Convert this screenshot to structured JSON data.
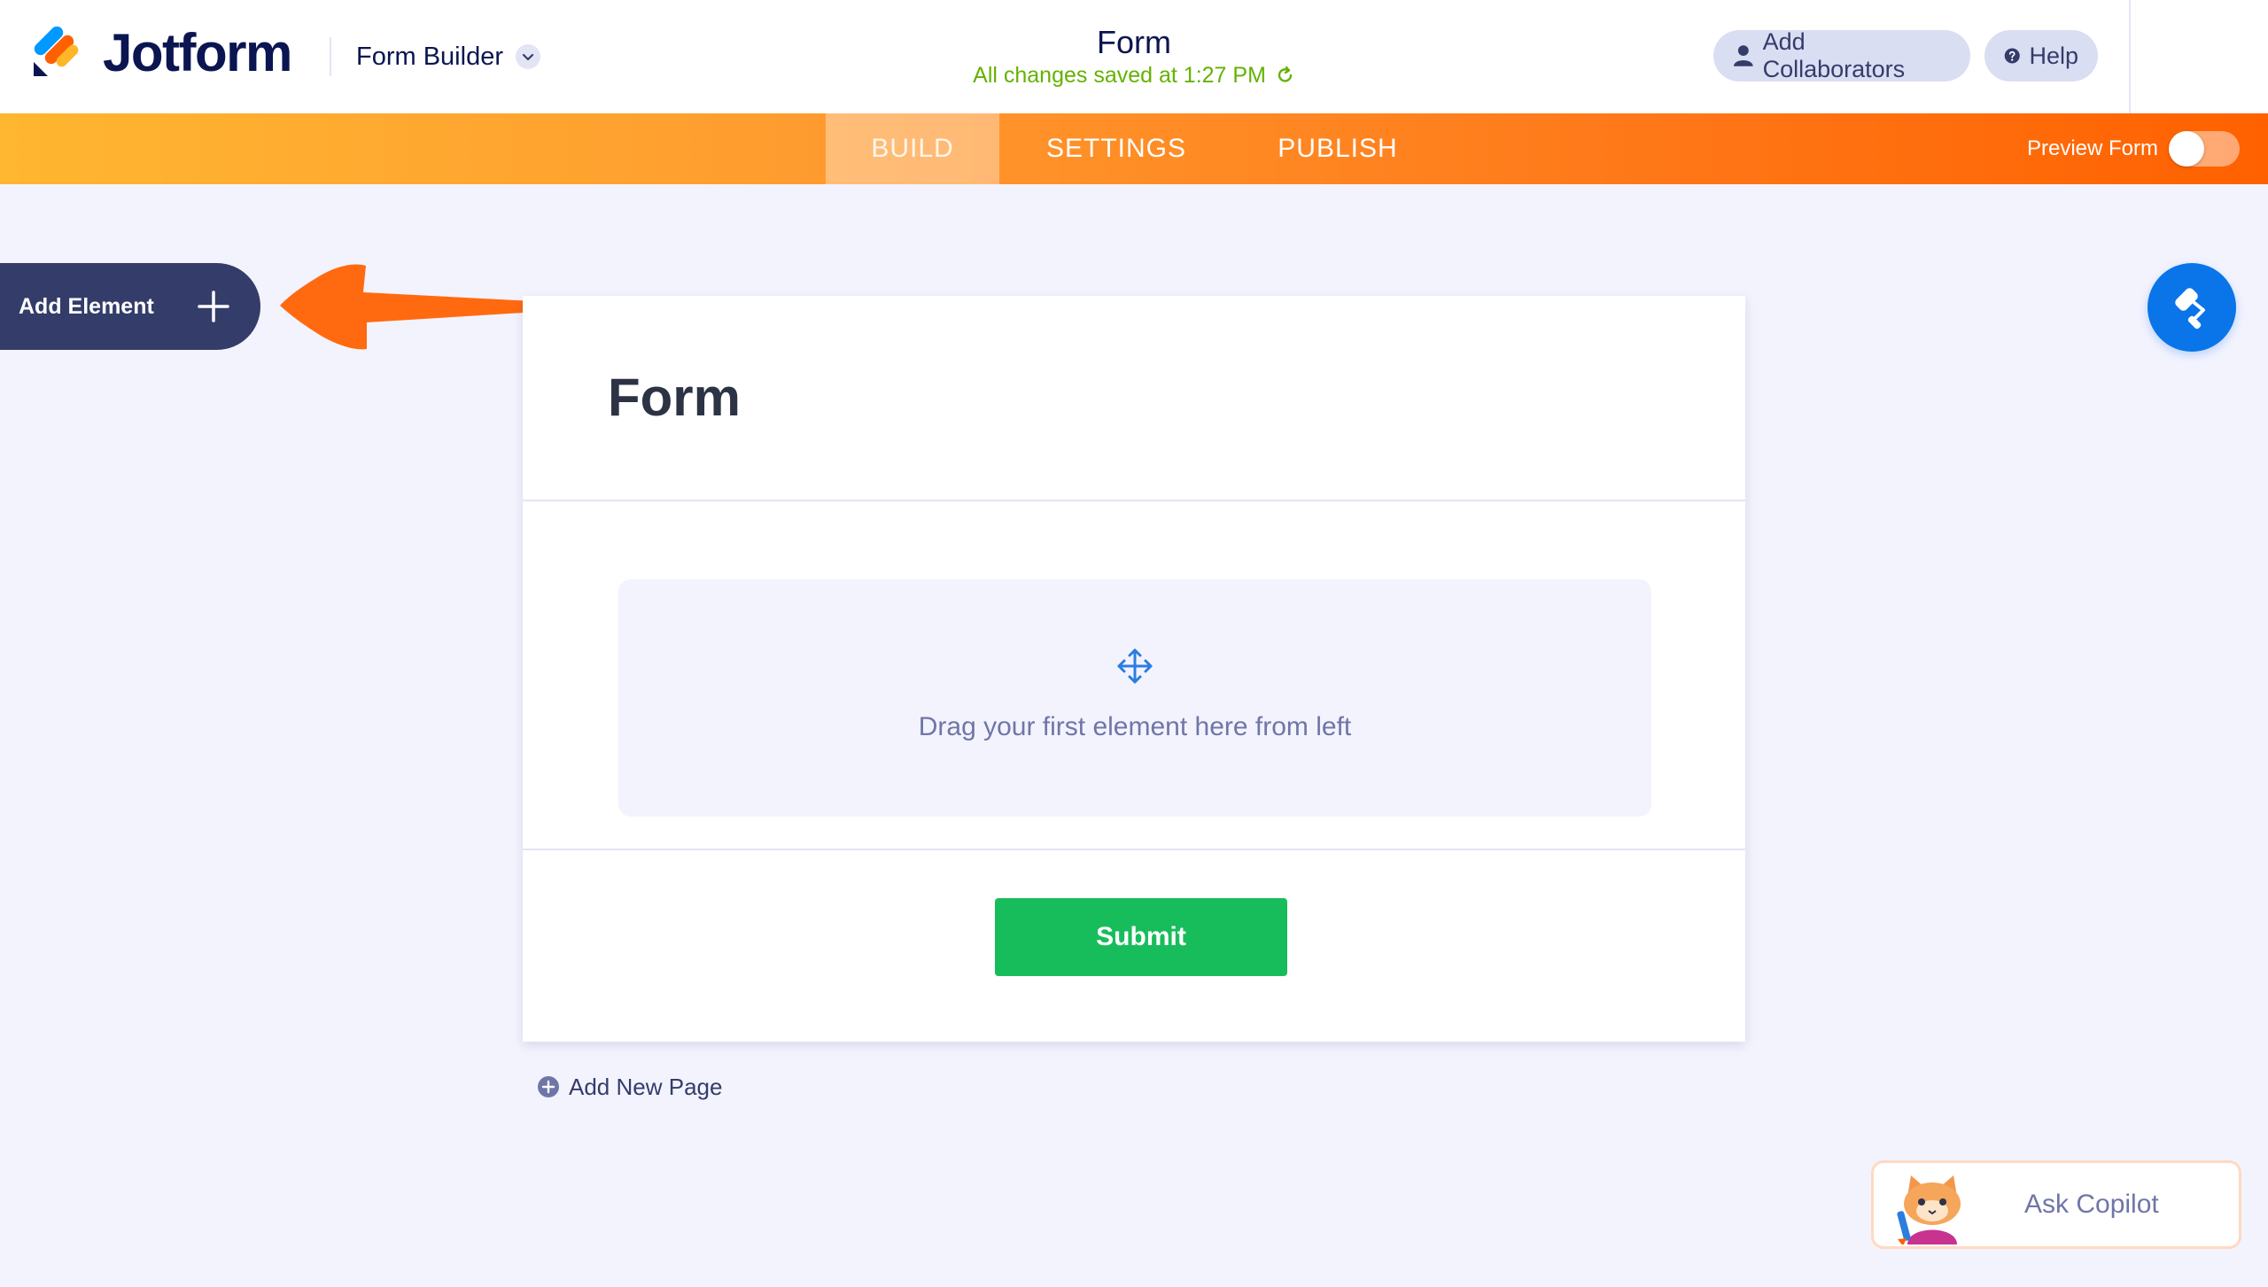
{
  "header": {
    "brand": "Jotform",
    "builder_label": "Form Builder",
    "form_title": "Form",
    "saved_status": "All changes saved at 1:27 PM",
    "collaborators_label": "Add Collaborators",
    "help_label": "Help"
  },
  "nav": {
    "tabs": [
      {
        "label": "BUILD",
        "active": true
      },
      {
        "label": "SETTINGS",
        "active": false
      },
      {
        "label": "PUBLISH",
        "active": false
      }
    ],
    "preview_label": "Preview Form",
    "preview_enabled": false
  },
  "sidebar": {
    "add_element_label": "Add Element"
  },
  "form": {
    "title": "Form",
    "dropzone_text": "Drag your first element here from left",
    "submit_label": "Submit"
  },
  "footer": {
    "add_page_label": "Add New Page"
  },
  "copilot": {
    "label": "Ask Copilot"
  },
  "colors": {
    "brand_dark": "#0a1551",
    "nav_orange": "#ff7a1a",
    "submit_green": "#18bd5b",
    "designer_blue": "#0a75e8",
    "saved_green": "#64b200"
  }
}
